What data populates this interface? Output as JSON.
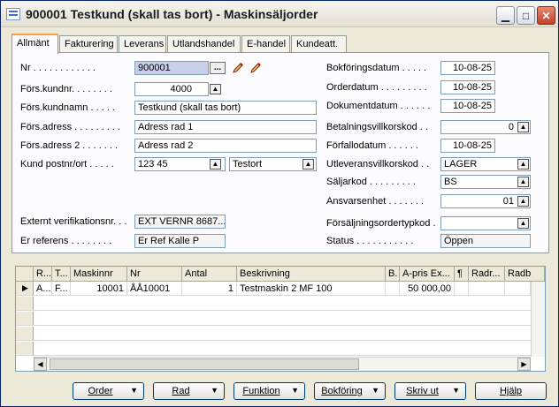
{
  "window": {
    "title": "900001 Testkund (skall tas bort) - Maskinsäljorder"
  },
  "tabs": [
    "Allmänt",
    "Fakturering",
    "Leverans",
    "Utlandshandel",
    "E-handel",
    "Kundeatt."
  ],
  "left_fields": {
    "nr": {
      "label": "Nr",
      "value": "900001"
    },
    "kundnr": {
      "label": "Förs.kundnr.",
      "value": "4000"
    },
    "kundnamn": {
      "label": "Förs.kundnamn",
      "value": "Testkund (skall tas bort)"
    },
    "adress": {
      "label": "Förs.adress",
      "value": "Adress rad 1"
    },
    "adress2": {
      "label": "Förs.adress 2",
      "value": "Adress rad 2"
    },
    "postnr": {
      "label": "Kund postnr/ort",
      "value": "123 45",
      "ort": "Testort"
    },
    "extvernr": {
      "label": "Externt verifikationsnr.",
      "value": "EXT VERNR 8687..."
    },
    "erref": {
      "label": "Er referens",
      "value": "Er Ref Kalle P"
    }
  },
  "right_fields": {
    "bokfdatum": {
      "label": "Bokföringsdatum",
      "value": "10-08-25"
    },
    "orderdatum": {
      "label": "Orderdatum",
      "value": "10-08-25"
    },
    "dokdatum": {
      "label": "Dokumentdatum",
      "value": "10-08-25"
    },
    "betvillkor": {
      "label": "Betalningsvillkorskod",
      "value": "0"
    },
    "forfallodatum": {
      "label": "Förfallodatum",
      "value": "10-08-25"
    },
    "utlevvillkor": {
      "label": "Utleveransvillkorskod",
      "value": "LAGER"
    },
    "saljarkod": {
      "label": "Säljarkod",
      "value": "BS"
    },
    "ansvarsenhet": {
      "label": "Ansvarsenhet",
      "value": "01"
    },
    "forsordertyp": {
      "label": "Försäljningsordertypkod",
      "value": ""
    },
    "status": {
      "label": "Status",
      "value": "Öppen"
    }
  },
  "lines": {
    "headers": [
      "R...",
      "T...",
      "Maskinnr",
      "Nr",
      "Antal",
      "Beskrivning",
      "B.",
      "A-pris Ex...",
      "¶",
      "Radr...",
      "Radb"
    ],
    "rows": [
      [
        "A...",
        "F...",
        "10001",
        "ÅÅ10001",
        "1",
        "Testmaskin 2 MF 100",
        "",
        "50 000,00",
        "",
        "",
        ""
      ]
    ]
  },
  "buttons": {
    "order": "Order",
    "rad": "Rad",
    "funktion": "Funktion",
    "bokforing": "Bokföring",
    "skrivut": "Skriv ut",
    "hjalp": "Hjälp"
  }
}
